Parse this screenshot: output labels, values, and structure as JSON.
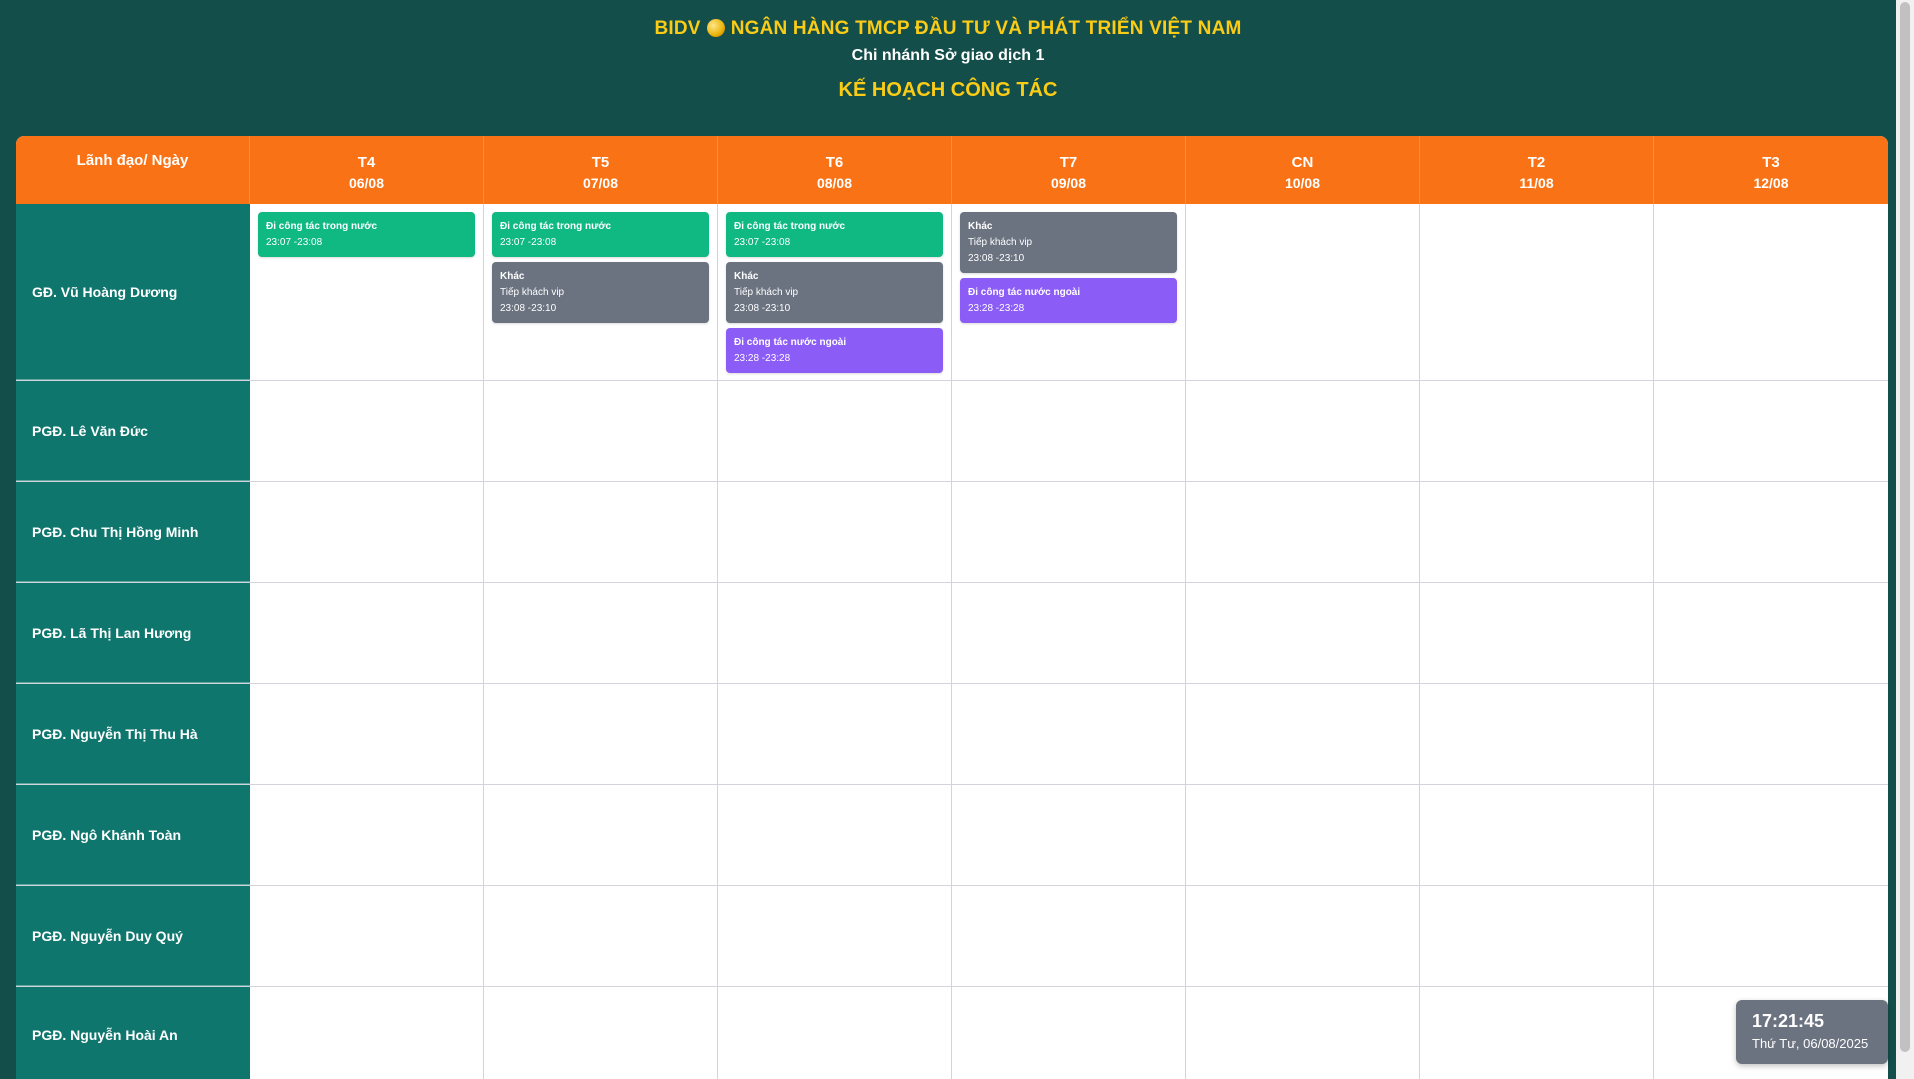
{
  "header": {
    "bank_code": "BIDV",
    "bank_name": "NGÂN HÀNG TMCP ĐẦU TƯ VÀ PHÁT TRIỂN VIỆT NAM",
    "branch": "Chi nhánh Sở giao dịch 1",
    "title": "KẾ HOẠCH CÔNG TÁC"
  },
  "table": {
    "corner_label": "Lãnh đạo/ Ngày",
    "days": [
      {
        "dow": "T4",
        "date": "06/08"
      },
      {
        "dow": "T5",
        "date": "07/08"
      },
      {
        "dow": "T6",
        "date": "08/08"
      },
      {
        "dow": "T7",
        "date": "09/08"
      },
      {
        "dow": "CN",
        "date": "10/08"
      },
      {
        "dow": "T2",
        "date": "11/08"
      },
      {
        "dow": "T3",
        "date": "12/08"
      }
    ],
    "leaders": [
      {
        "name": "GĐ. Vũ Hoàng Dương"
      },
      {
        "name": "PGĐ. Lê Văn Đức"
      },
      {
        "name": "PGĐ. Chu Thị Hồng Minh"
      },
      {
        "name": "PGĐ. Lã Thị Lan Hương"
      },
      {
        "name": "PGĐ. Nguyễn Thị Thu Hà"
      },
      {
        "name": "PGĐ. Ngô Khánh Toàn"
      },
      {
        "name": "PGĐ. Nguyễn Duy Quý"
      },
      {
        "name": "PGĐ. Nguyễn Hoài An"
      }
    ],
    "events": {
      "d0": [
        {
          "title": "Đi công tác trong nước",
          "time": "23:07 -23:08",
          "color": "#10b981"
        }
      ],
      "d1": [
        {
          "title": "Đi công tác trong nước",
          "time": "23:07 -23:08",
          "color": "#10b981"
        },
        {
          "title": "Khác",
          "desc": "Tiếp khách vip",
          "time": "23:08 -23:10",
          "color": "#6b7280"
        }
      ],
      "d2": [
        {
          "title": "Đi công tác trong nước",
          "time": "23:07 -23:08",
          "color": "#10b981"
        },
        {
          "title": "Khác",
          "desc": "Tiếp khách vip",
          "time": "23:08 -23:10",
          "color": "#6b7280"
        },
        {
          "title": "Đi công tác nước ngoài",
          "time": "23:28 -23:28",
          "color": "#8b5cf6"
        }
      ],
      "d3": [
        {
          "title": "Khác",
          "desc": "Tiếp khách vip",
          "time": "23:08 -23:10",
          "color": "#6b7280"
        },
        {
          "title": "Đi công tác nước ngoài",
          "time": "23:28 -23:28",
          "color": "#8b5cf6"
        }
      ]
    }
  },
  "clock": {
    "time": "17:21:45",
    "date": "Thứ Tư, 06/08/2025"
  },
  "colors": {
    "background": "#134e4a",
    "header_accent": "#facc15",
    "table_header": "#f97316",
    "name_column": "#0f766e"
  }
}
